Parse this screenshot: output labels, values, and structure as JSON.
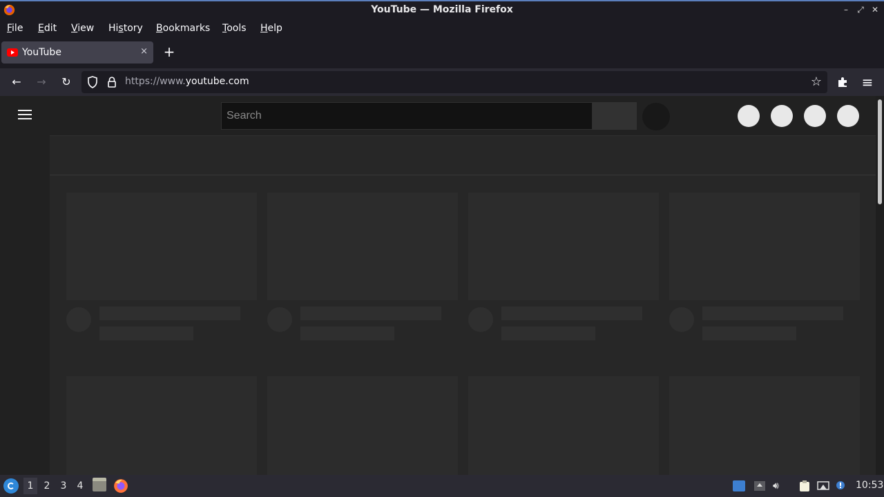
{
  "window": {
    "title": "YouTube — Mozilla Firefox"
  },
  "menubar": {
    "items": [
      {
        "label": "File",
        "accel": "F",
        "rest": "ile"
      },
      {
        "label": "Edit",
        "accel": "E",
        "rest": "dit"
      },
      {
        "label": "View",
        "accel": "V",
        "rest": "iew"
      },
      {
        "label": "History",
        "pre": "Hi",
        "accel": "s",
        "rest": "tory"
      },
      {
        "label": "Bookmarks",
        "accel": "B",
        "rest": "ookmarks"
      },
      {
        "label": "Tools",
        "accel": "T",
        "rest": "ools"
      },
      {
        "label": "Help",
        "accel": "H",
        "rest": "elp"
      }
    ]
  },
  "tabs": [
    {
      "label": "YouTube",
      "close": "×"
    }
  ],
  "newtab": "+",
  "nav": {
    "back": "←",
    "forward": "→",
    "reload": "↻",
    "url_scheme": "https://www.",
    "url_host": "youtube.com",
    "bookmark_star": "☆",
    "menu": "≡"
  },
  "page": {
    "search_placeholder": "Search"
  },
  "taskbar": {
    "workspaces": [
      "1",
      "2",
      "3",
      "4"
    ],
    "active_workspace": "1",
    "clock": "10:53"
  },
  "colors": {
    "accent": "#5b7fbd",
    "youtube_red": "#ff0000",
    "page_bg": "#212121"
  }
}
